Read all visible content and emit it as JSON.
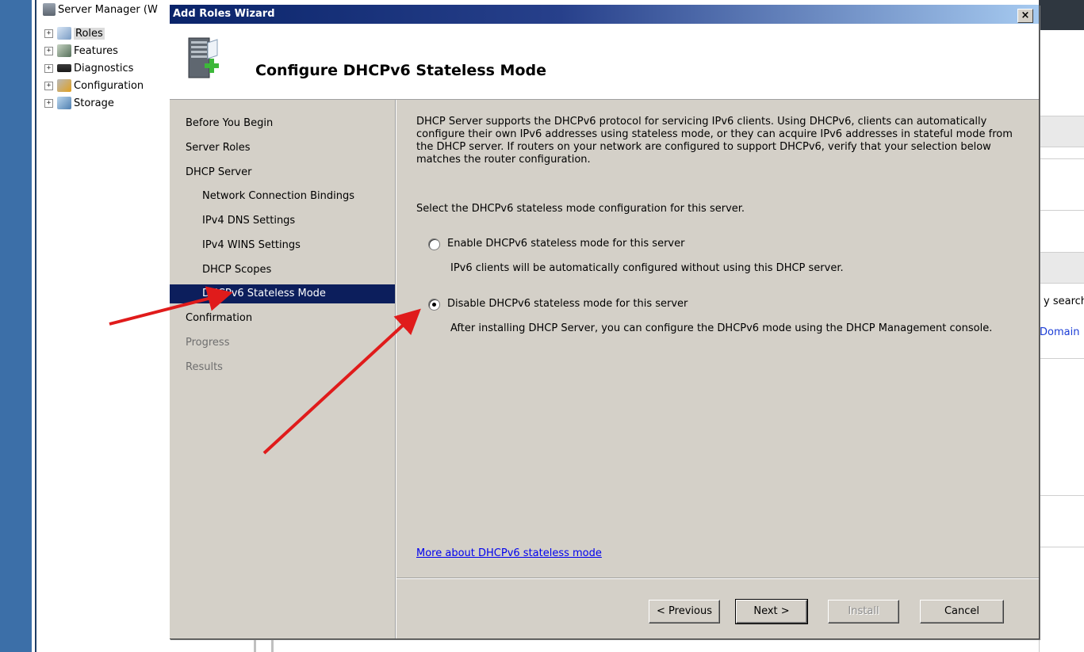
{
  "server_manager": {
    "title": "Server Manager (W",
    "tree": [
      {
        "label": "Roles",
        "expander": "+",
        "icon": "roles-icon",
        "selected": true
      },
      {
        "label": "Features",
        "expander": "+",
        "icon": "features-icon",
        "selected": false
      },
      {
        "label": "Diagnostics",
        "expander": "+",
        "icon": "diagnostics-icon",
        "selected": false
      },
      {
        "label": "Configuration",
        "expander": "+",
        "icon": "configuration-icon",
        "selected": false
      },
      {
        "label": "Storage",
        "expander": "+",
        "icon": "storage-icon",
        "selected": false
      }
    ],
    "right_panel": {
      "search_fragment": "y search",
      "domain_link_fragment": "Domain"
    }
  },
  "wizard": {
    "window_title": "Add Roles Wizard",
    "close_label": "×",
    "page_title": "Configure DHCPv6 Stateless Mode",
    "nav": [
      {
        "label": "Before You Begin",
        "level": 0,
        "state": "normal"
      },
      {
        "label": "Server Roles",
        "level": 0,
        "state": "normal"
      },
      {
        "label": "DHCP Server",
        "level": 0,
        "state": "normal"
      },
      {
        "label": "Network Connection Bindings",
        "level": 1,
        "state": "normal"
      },
      {
        "label": "IPv4 DNS Settings",
        "level": 1,
        "state": "normal"
      },
      {
        "label": "IPv4 WINS Settings",
        "level": 1,
        "state": "normal"
      },
      {
        "label": "DHCP Scopes",
        "level": 1,
        "state": "normal"
      },
      {
        "label": "DHCPv6 Stateless Mode",
        "level": 1,
        "state": "current"
      },
      {
        "label": "Confirmation",
        "level": 0,
        "state": "normal"
      },
      {
        "label": "Progress",
        "level": 0,
        "state": "disabled"
      },
      {
        "label": "Results",
        "level": 0,
        "state": "disabled"
      }
    ],
    "description": "DHCP Server supports the DHCPv6 protocol for servicing IPv6 clients. Using DHCPv6, clients can automatically configure their own IPv6 addresses using stateless mode, or they can acquire IPv6 addresses in stateful mode from the DHCP server. If routers on your network are configured to support DHCPv6, verify that your selection below matches the router configuration.",
    "prompt": "Select the DHCPv6 stateless mode configuration for this server.",
    "options": [
      {
        "label": "Enable DHCPv6 stateless mode for this server",
        "help": "IPv6 clients will be automatically configured without using this DHCP server.",
        "selected": false
      },
      {
        "label": "Disable DHCPv6 stateless mode for this server",
        "help": "After installing DHCP Server, you can configure the DHCPv6 mode using the DHCP Management console.",
        "selected": true
      }
    ],
    "more_link": "More about DHCPv6 stateless mode",
    "buttons": {
      "previous": "< Previous",
      "next": "Next >",
      "install": "Install",
      "cancel": "Cancel"
    },
    "install_enabled": false
  },
  "colors": {
    "titlebar": "#0a246a",
    "dialog_bg": "#d4d0c8",
    "selected_nav": "#0c1e5c",
    "annotation_arrow": "#e01b1b",
    "link": "#0000ee"
  }
}
